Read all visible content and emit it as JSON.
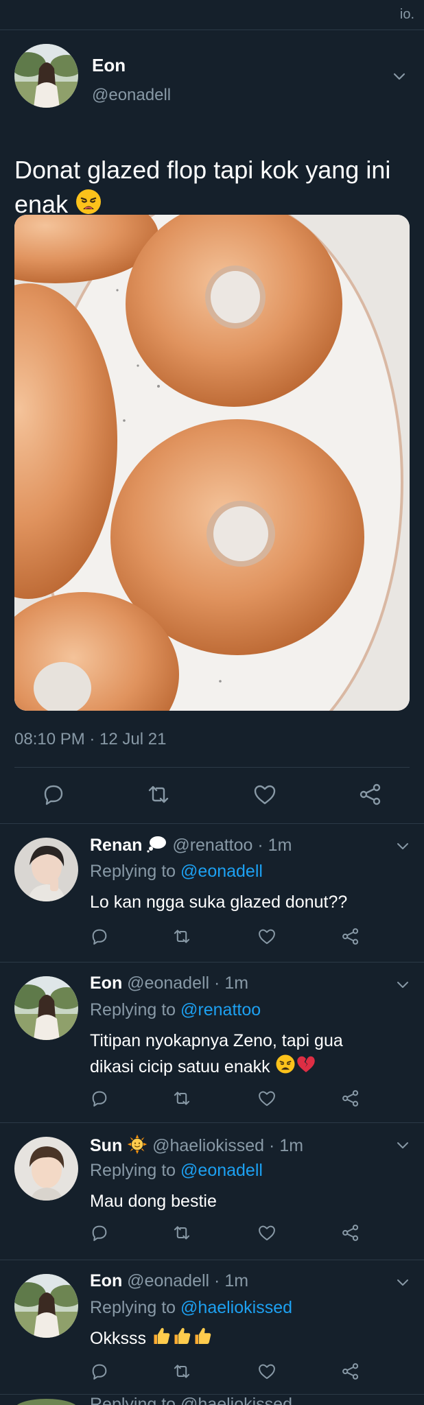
{
  "topbar": {
    "text": "io."
  },
  "main_tweet": {
    "author_name": "Eon",
    "author_handle": "@eonadell",
    "text": "Donat glazed flop tapi kok yang ini enak",
    "text_emoji": "weary-face",
    "photo_alt": "glazed-donuts-photo",
    "timestamp": "08:10 PM · 12 Jul 21"
  },
  "replies": [
    {
      "name": "Renan",
      "name_emoji": "thought-balloon",
      "handle": "@renattoo",
      "time": "· 1m",
      "replying_prefix": "Replying to ",
      "replying_to": "@eonadell",
      "text": "Lo kan ngga suka glazed donut??"
    },
    {
      "name": "Eon",
      "handle": "@eonadell",
      "time": "· 1m",
      "replying_prefix": "Replying to ",
      "replying_to": "@renattoo",
      "text_line1": "Titipan nyokapnya Zeno, tapi gua",
      "text_line2": "dikasi cicip satuu enakk",
      "text_emojis": [
        "weary-face",
        "broken-heart"
      ]
    },
    {
      "name": "Sun",
      "name_emoji": "sun-with-face",
      "handle": "@haeliokissed",
      "time": "· 1m",
      "replying_prefix": "Replying to ",
      "replying_to": "@eonadell",
      "text": "Mau dong bestie"
    },
    {
      "name": "Eon",
      "handle": "@eonadell",
      "time": "· 1m",
      "replying_prefix": "Replying to ",
      "replying_to": "@haeliokissed",
      "text": "Okksss",
      "text_emojis": [
        "thumbs-up",
        "thumbs-up",
        "thumbs-up"
      ]
    }
  ],
  "bottom_peek": {
    "text": "Replying to @haeliokissed"
  },
  "colors": {
    "background": "#15202b",
    "divider": "#2c3a47",
    "secondary_text": "#8899a6",
    "mention": "#1da1f2"
  }
}
